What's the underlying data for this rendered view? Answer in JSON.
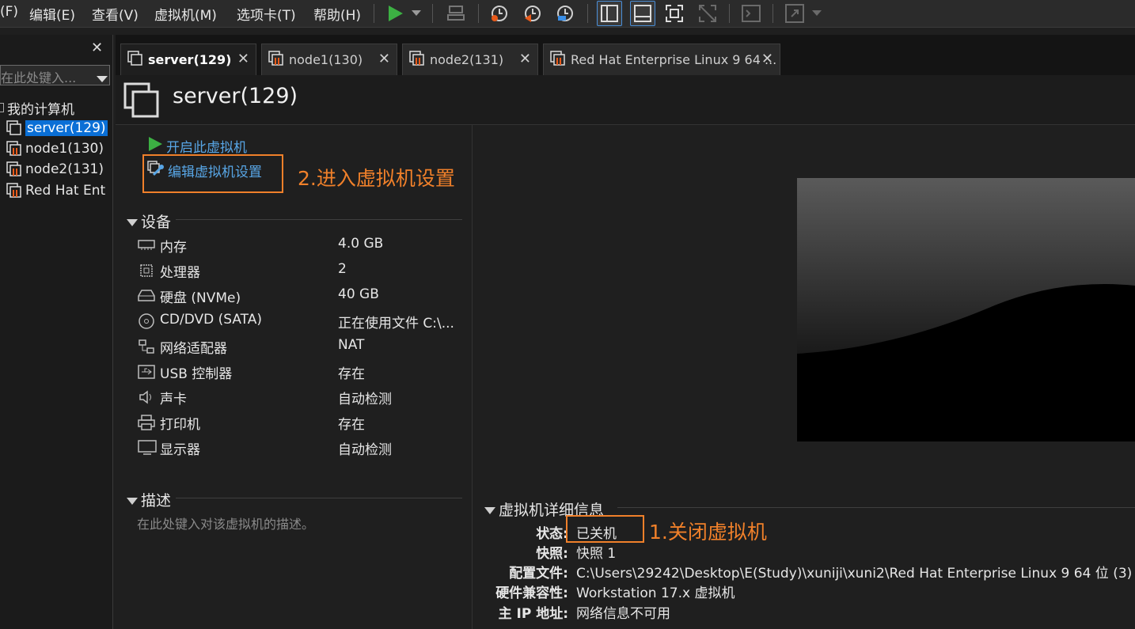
{
  "menu": [
    "(F)",
    "编辑(E)",
    "查看(V)",
    "虚拟机(M)",
    "选项卡(T)",
    "帮助(H)"
  ],
  "sidebar": {
    "close": "✕",
    "search_placeholder": "在此处键入...",
    "root": "我的计算机",
    "items": [
      "server(129)",
      "node1(130)",
      "node2(131)",
      "Red Hat Ent"
    ]
  },
  "tabs": [
    {
      "label": "server(129)",
      "active": true
    },
    {
      "label": "node1(130)"
    },
    {
      "label": "node2(131)"
    },
    {
      "label": "Red Hat Enterprise Linux 9 64 ..."
    }
  ],
  "vm": {
    "title": "server(129)",
    "actions": {
      "power_on": "开启此虚拟机",
      "edit_settings": "编辑虚拟机设置"
    }
  },
  "devices": {
    "heading": "设备",
    "items": [
      {
        "icon": "memory-icon",
        "name": "内存",
        "value": "4.0 GB"
      },
      {
        "icon": "cpu-icon",
        "name": "处理器",
        "value": "2"
      },
      {
        "icon": "disk-icon",
        "name": "硬盘 (NVMe)",
        "value": "40 GB"
      },
      {
        "icon": "cd-icon",
        "name": "CD/DVD (SATA)",
        "value": "正在使用文件 C:\\..."
      },
      {
        "icon": "network-icon",
        "name": "网络适配器",
        "value": "NAT"
      },
      {
        "icon": "usb-icon",
        "name": "USB 控制器",
        "value": "存在"
      },
      {
        "icon": "sound-icon",
        "name": "声卡",
        "value": "自动检测"
      },
      {
        "icon": "printer-icon",
        "name": "打印机",
        "value": "存在"
      },
      {
        "icon": "display-icon",
        "name": "显示器",
        "value": "自动检测"
      }
    ]
  },
  "description": {
    "heading": "描述",
    "placeholder": "在此处键入对该虚拟机的描述。"
  },
  "details": {
    "heading": "虚拟机详细信息",
    "state_label": "状态:",
    "state": "已关机",
    "snapshot_label": "快照:",
    "snapshot": "快照 1",
    "config_label": "配置文件:",
    "config": "C:\\Users\\29242\\Desktop\\E(Study)\\xuniji\\xuni2\\Red Hat Enterprise Linux 9 64 位 (3)",
    "compat_label": "硬件兼容性:",
    "compat": "Workstation 17.x 虚拟机",
    "ip_label": "主 IP 地址:",
    "ip": "网络信息不可用"
  },
  "annotations": {
    "step1": "1.关闭虚拟机",
    "step2": "2.进入虚拟机设置"
  },
  "colors": {
    "accent_orange": "#f0802a",
    "link_blue": "#58a6e6",
    "play_green": "#3cb043",
    "bg": "#1f1f1f"
  }
}
